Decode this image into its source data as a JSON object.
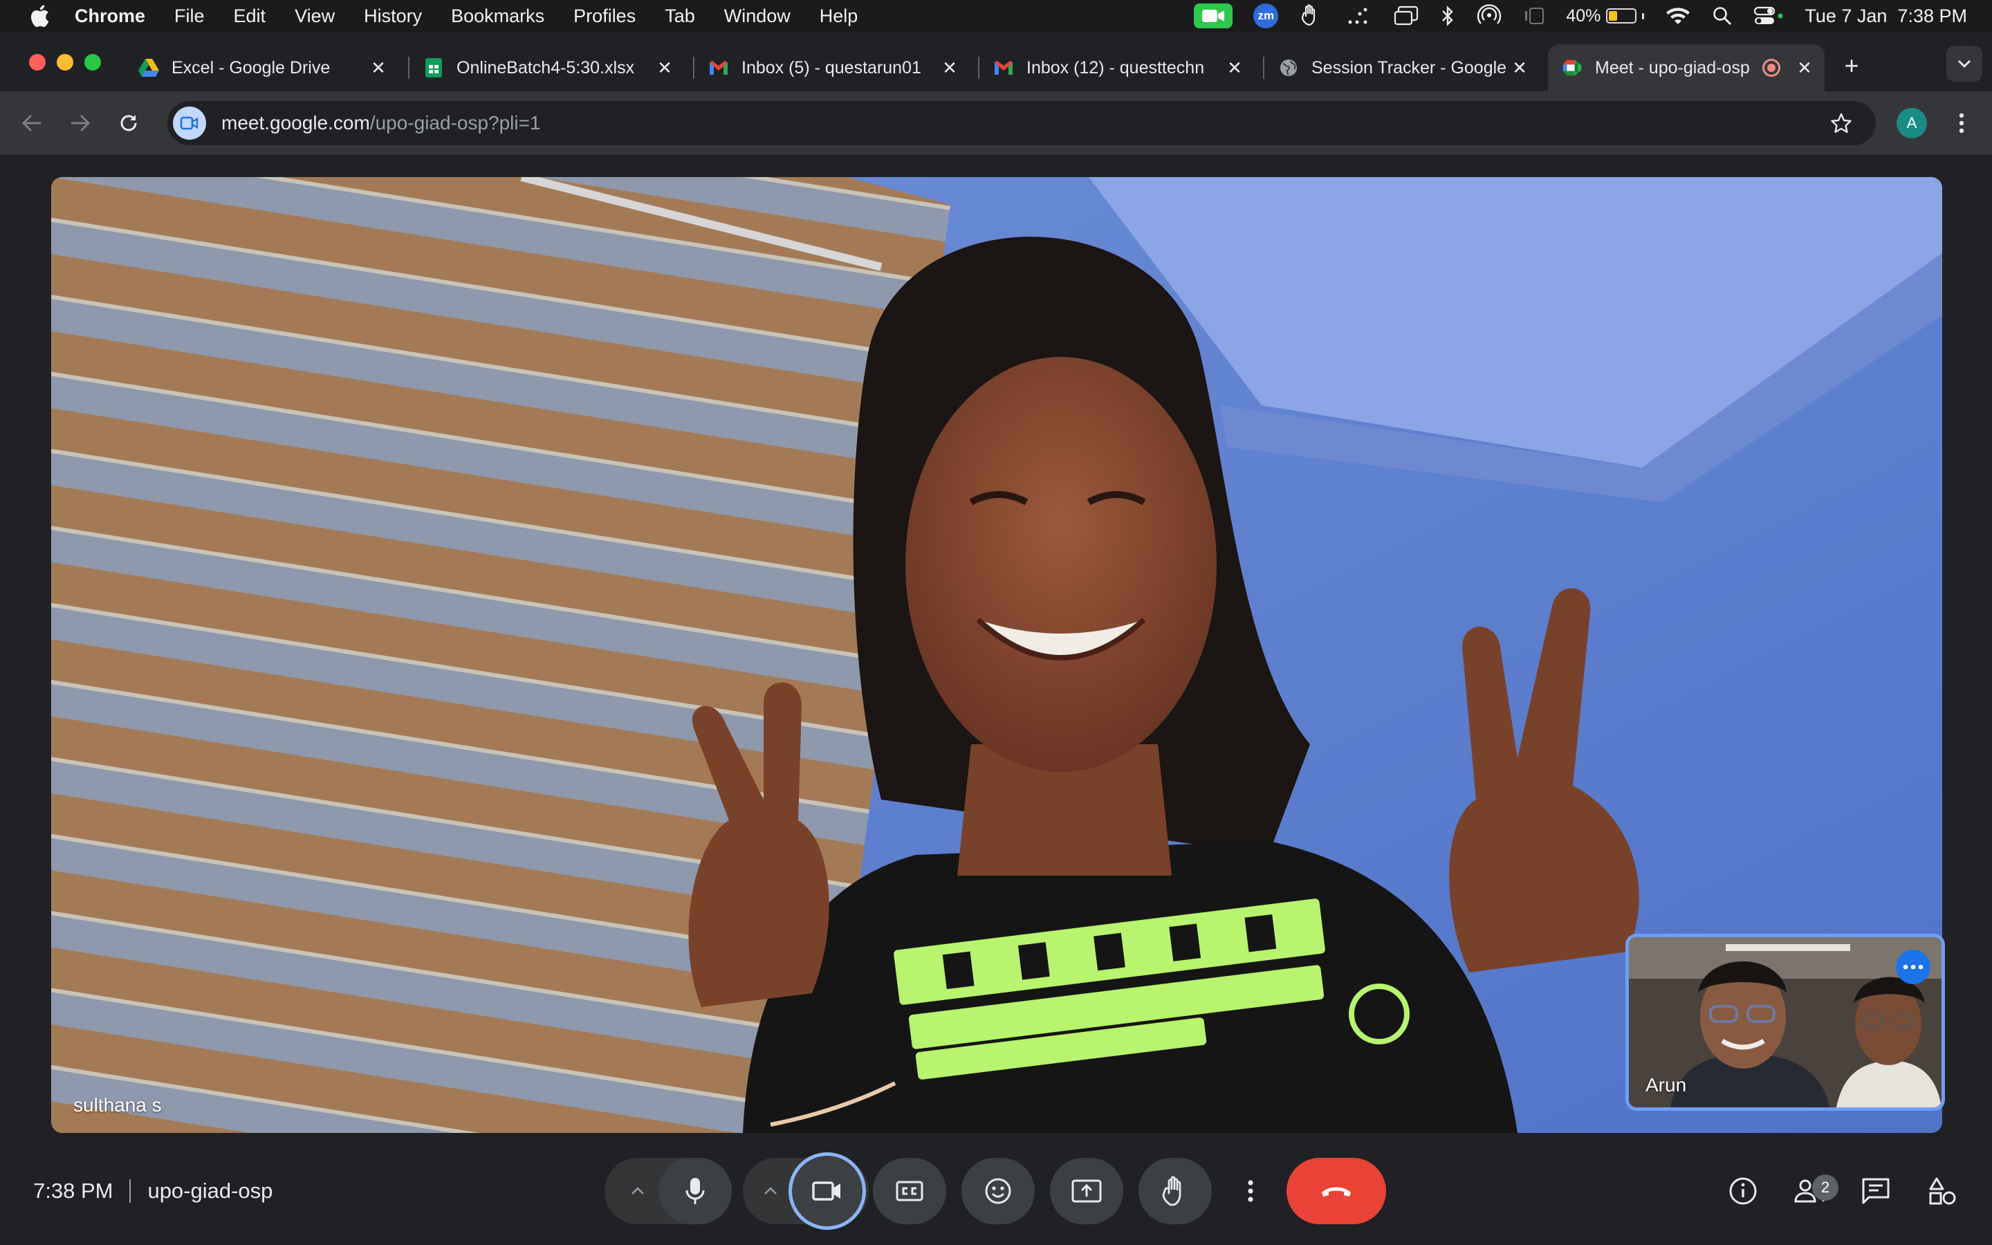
{
  "menubar": {
    "app": "Chrome",
    "items": [
      "File",
      "Edit",
      "View",
      "History",
      "Bookmarks",
      "Profiles",
      "Tab",
      "Window",
      "Help"
    ],
    "zoom_badge": "zm",
    "battery_percent": "40%",
    "battery_level": 0.4,
    "datetime": "Tue 7 Jan  7:38 PM",
    "status_icons": [
      "facetime-camera-icon",
      "zoom-icon",
      "hand-icon",
      "dots-icon",
      "screen-mirror-icon",
      "bluetooth-icon",
      "airdrop-icon",
      "stage-manager-icon",
      "battery-icon",
      "wifi-icon",
      "spotlight-icon",
      "control-center-icon"
    ]
  },
  "tabs": [
    {
      "title": "Excel - Google Drive",
      "icon": "google-drive-icon"
    },
    {
      "title": "OnlineBatch4-5:30.xlsx",
      "icon": "google-sheets-icon"
    },
    {
      "title": "Inbox (5) - questarun01",
      "icon": "gmail-icon"
    },
    {
      "title": "Inbox (12) - questtechn",
      "icon": "gmail-icon"
    },
    {
      "title": "Session Tracker - Google",
      "icon": "globe-icon"
    },
    {
      "title": "Meet - upo-giad-osp",
      "icon": "google-meet-icon",
      "active": true,
      "recording": true
    }
  ],
  "toolbar": {
    "url_host": "meet.google.com",
    "url_path": "/upo-giad-osp?pli=1",
    "profile_initial": "A"
  },
  "meet": {
    "main_participant": "sulthana s",
    "pip_participant": "Arun",
    "time": "7:38 PM",
    "meeting_code": "upo-giad-osp",
    "participant_count": "2"
  },
  "colors": {
    "end_call": "#ea4335",
    "active_outline": "#8ab4f8",
    "meet_blue": "#1a73e8"
  }
}
